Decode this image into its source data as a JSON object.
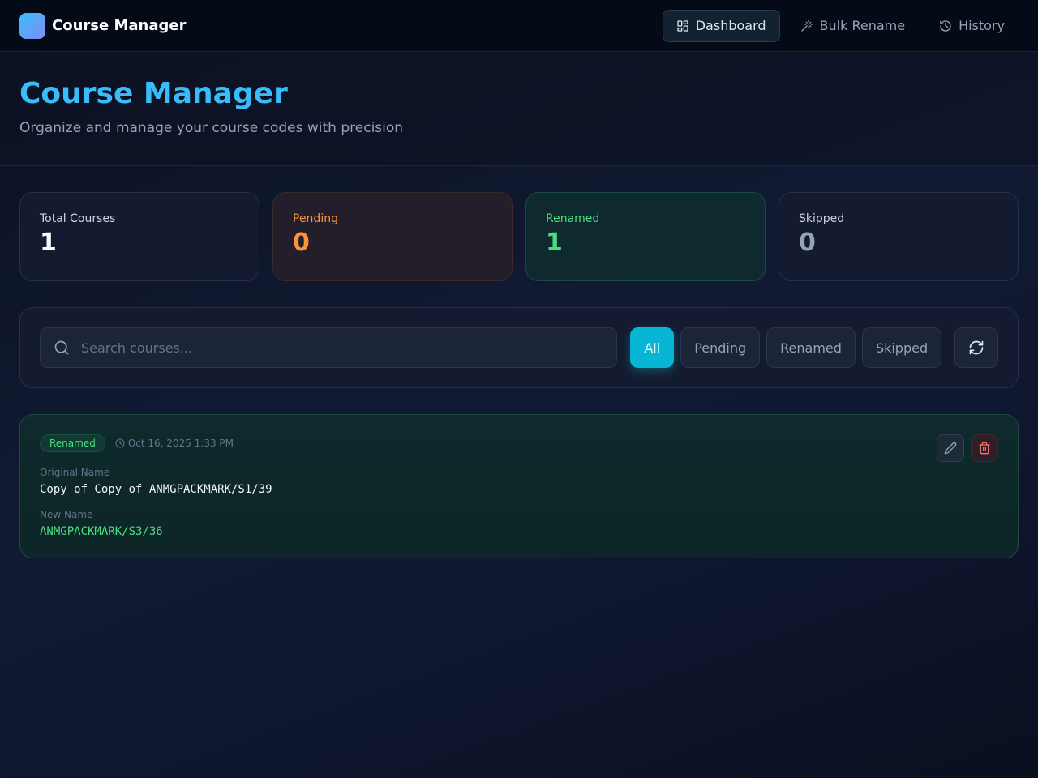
{
  "app": {
    "name": "Course Manager"
  },
  "nav": {
    "items": [
      {
        "label": "Dashboard",
        "icon": "grid-icon",
        "active": true
      },
      {
        "label": "Bulk Rename",
        "icon": "magic-wand-icon",
        "active": false
      },
      {
        "label": "History",
        "icon": "history-icon",
        "active": false
      }
    ]
  },
  "header": {
    "title": "Course Manager",
    "subtitle": "Organize and manage your course codes with precision"
  },
  "stats": {
    "total": {
      "label": "Total Courses",
      "value": "1"
    },
    "pending": {
      "label": "Pending",
      "value": "0"
    },
    "renamed": {
      "label": "Renamed",
      "value": "1"
    },
    "skipped": {
      "label": "Skipped",
      "value": "0"
    }
  },
  "filters": {
    "search_placeholder": "Search courses...",
    "search_value": "",
    "buttons": [
      "All",
      "Pending",
      "Renamed",
      "Skipped"
    ],
    "active": "All"
  },
  "courses": [
    {
      "status": "Renamed",
      "date": "Oct 16, 2025 1:33 PM",
      "original_label": "Original Name",
      "original": "Copy of Copy of ANMGPACKMARK/S1/39",
      "new_label": "New Name",
      "new": "ANMGPACKMARK/S3/36"
    }
  ],
  "colors": {
    "accent": "#06b6d4",
    "title": "#38bdf8",
    "pending": "#fb923c",
    "renamed": "#4ade80",
    "danger": "#f87171"
  }
}
